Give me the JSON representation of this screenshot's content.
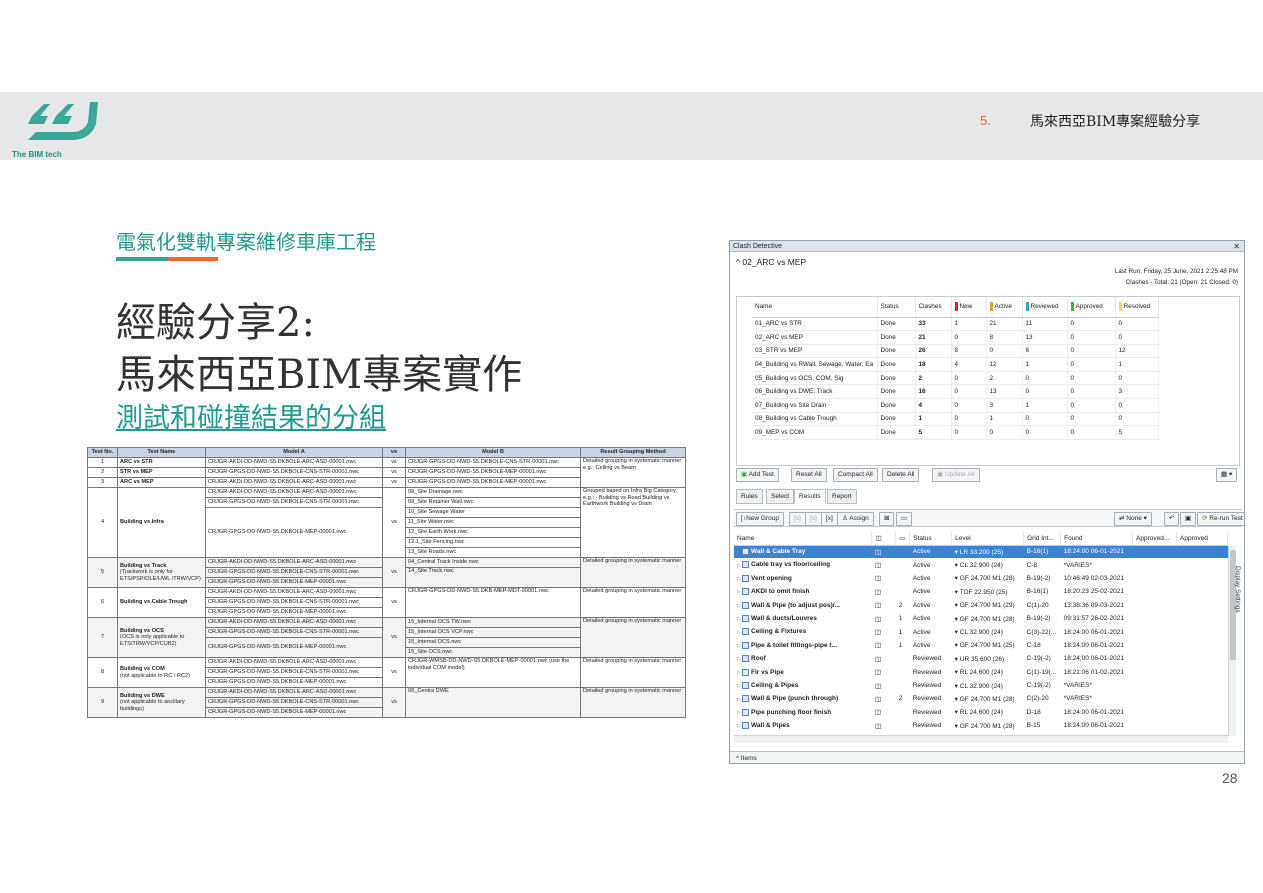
{
  "header": {
    "logo_text": "The BIM tech",
    "section_number": "5.",
    "section_title": "馬來西亞BIM專案經驗分享"
  },
  "slide": {
    "project_title": "電氣化雙軌專案維修車庫工程",
    "title_line1": "經驗分享2:",
    "title_line2": "馬來西亞BIM專案實作",
    "subtitle": "測試和碰撞結果的分組",
    "page_number": "28"
  },
  "test_table": {
    "headers": [
      "Test No.",
      "Test Name",
      "Model A",
      "vs",
      "Model B",
      "Result Grouping Method"
    ],
    "rows": [
      {
        "no": "1",
        "name": "ARC vs STR",
        "a": "CRJGR-AKDI-DD-NWD-S5.DKBOLE-ARC-ASD-00001.nwc",
        "vs": "vs",
        "b": "CRJGR-GPGS-DD-NWD-S5.DKBOLE-CNS-STR-00001.nwc",
        "method": "Detailed grouping in systematic manner e.g.: Ceiling vs Beam"
      },
      {
        "no": "2",
        "name": "STR vs MEP",
        "a": "CRJGR-GPGS-DD-NWD-S5.DKBOLE-CNS-STR-00001.nwc",
        "vs": "vs",
        "b": "CRJGR-GPGS-DD-NWD-S5.DKBOLE-MEP-00001.nwc"
      },
      {
        "no": "3",
        "name": "ARC vs MEP",
        "a": "CRJGR-AKDI-DD-NWD-S5.DKBOLE-ARC-ASD-00001.nwc",
        "vs": "vs",
        "b": "CRJGR-GPGS-DD-NWD-S5.DKBOLE-MEP-00001.nwc"
      },
      {
        "no": "4",
        "name": "Building vs Infra",
        "a_list": [
          "CRJGR-AKDI-DD-NWD-S5.DKBOLE-ARC-ASD-00001.nwc",
          "CRJGR-GPGS-DD-NWD-S5.DKBOLE-CNS-STR-00001.nwc",
          "CRJGR-GPGS-DD-NWD-S5.DKBOLE-MEP-00001.nwc"
        ],
        "vs": "vs",
        "b_list": [
          "08_Site Drainage.nwc",
          "09_Site Retainer Wall.nwc",
          "10_Site Sewage Water",
          "11_Site Water.nwc",
          "12_Site Earth Work.nwc",
          "12.1_Site Fencing.nwc",
          "13_Site Roads.nwc"
        ],
        "method": "Grouped based on Infra Big Category, e.g.: - Building vs Road Building vs Earthwork Building vs Drain"
      },
      {
        "no": "5",
        "name": "Building vs Track",
        "name_note": "(Trackwork is only for ETS/PSP/OLE/UWL /TRW/VCP)",
        "a_list": [
          "CRJGR-AKDI-DD-NWD-S5.DKBOLE-ARC-ASD-00001.nwc",
          "CRJGR-GPGS-DD-NWD-S5.DKBOLE-CNS-STR-00001.nwc",
          "CRJGR-GPGS-DD-NWD-S5.DKBOLE-MEP-00001.nwc"
        ],
        "vs": "vs",
        "b_list": [
          "04_Central Track Inside.nwc",
          "14_Site Track.nwc"
        ],
        "method": "Detailed grouping in systematic manner"
      },
      {
        "no": "6",
        "name": "Building vs Cable Trough",
        "a_list": [
          "CRJGR-AKDI-DD-NWD-S5.DKBOLE-ARC-ASD-00001.nwc",
          "CRJGR-GPGS-DD-NWD-S5.DKBOLE-CNS-STR-00001.nwc",
          "CRJGR-GPGS-DD-NWD-S5.DKBOLE-MEP-00001.nwc"
        ],
        "vs": "vs",
        "b": "CRJGR-GPGS-DD-NWD-S5.DKB-MEP-MDT-00001.nwc",
        "method": "Detailed grouping in systematic manner"
      },
      {
        "no": "7",
        "name": "Building vs OCS",
        "name_note": "(OCS is only applicable to ETS/TRW/VCP/CUB2)",
        "a_list": [
          "CRJGR-AKDI-DD-NWD-S5.DKBOLE-ARC-ASD-00001.nwc",
          "CRJGR-GPGS-DD-NWD-S5.DKBOLE-CNS-STR-00001.nwc",
          "CRJGR-GPGS-DD-NWD-S5.DKBOLE-MEP-00001.nwc"
        ],
        "vs": "vs",
        "b_list": [
          "15_Internal OCS TW.nwc",
          "15_Internal OCS VCP.nwc",
          "15_Internal OCS.nwc",
          "15_Site OCS.nwc"
        ],
        "method": "Detailed grouping in systematic manner"
      },
      {
        "no": "8",
        "name": "Building vs COM",
        "name_note": "(not applicable to RC / RC2)",
        "a_list": [
          "CRJGR-AKDI-DD-NWD-S5.DKBOLE-ARC-ASD-00001.nwc",
          "CRJGR-GPGS-DD-NWD-S5.DKBOLE-CNS-STR-00001.nwc",
          "CRJGR-GPGS-DD-NWD-S5.DKBOLE-MEP-00001.nwc"
        ],
        "vs": "vs",
        "b": "CRJGR-WMSB-DD-NWD-S5.DKBOLE-MEP-00001.nwc (use the individual COM model)",
        "method": "Detailed grouping in systematic manner"
      },
      {
        "no": "9",
        "name": "Building vs DWE",
        "name_note": "(not applicable to ancillary buildings)",
        "a_list": [
          "CRJGR-AKDI-DD-NWD-S5.DKBOLE-ARC-ASD-00001.nwc",
          "CRJGR-GPGS-DD-NWD-S5.DKBOLE-CNS-STR-00001.nwc",
          "CRJGR-GPGS-DD-NWD-S5.DKBOLE-MEP-00001.nwc"
        ],
        "vs": "vs",
        "b": "00_Centra DWE",
        "method": "Detailed grouping in systematic manner"
      }
    ]
  },
  "clash": {
    "window_title": "Clash Detective",
    "current_test": "02_ARC vs MEP",
    "last_run": "Last Run:  Friday, 25 June, 2021 2:25:48 PM",
    "summary": "Clashes - Total: 21  (Open: 21  Closed: 0)",
    "test_headers": [
      "Name",
      "Status",
      "Clashes",
      "New",
      "Active",
      "Reviewed",
      "Approved",
      "Resolved"
    ],
    "status_colors": {
      "new": "#e02020",
      "active": "#f0a020",
      "reviewed": "#30a0e0",
      "approved": "#30c030",
      "resolved": "#f0e040"
    },
    "tests": [
      [
        "01_ARC vs STR",
        "Done",
        "33",
        "1",
        "21",
        "11",
        "0",
        "0"
      ],
      [
        "02_ARC vs MEP",
        "Done",
        "21",
        "0",
        "8",
        "13",
        "0",
        "0"
      ],
      [
        "03_STR vs MEP",
        "Done",
        "26",
        "8",
        "0",
        "6",
        "0",
        "12"
      ],
      [
        "04_Building vs RWall, Sewage, Water, Ea",
        "Done",
        "18",
        "4",
        "12",
        "1",
        "0",
        "1"
      ],
      [
        "05_Building vs OCS, COM, Sig",
        "Done",
        "2",
        "0",
        "2",
        "0",
        "0",
        "0"
      ],
      [
        "06_Building vs DWE, Track",
        "Done",
        "16",
        "0",
        "13",
        "0",
        "0",
        "3"
      ],
      [
        "07_Building vs Site Drain",
        "Done",
        "4",
        "0",
        "3",
        "1",
        "0",
        "0"
      ],
      [
        "08_Building vs Cable Trough",
        "Done",
        "1",
        "0",
        "1",
        "0",
        "0",
        "0"
      ],
      [
        "09_MEP vs COM",
        "Done",
        "5",
        "0",
        "0",
        "0",
        "0",
        "5"
      ]
    ],
    "buttons": {
      "add_test": "Add Test",
      "reset_all": "Reset All",
      "compact_all": "Compact All",
      "delete_all": "Delete All",
      "update_all": "Update All"
    },
    "tabs": [
      "Rules",
      "Select",
      "Results",
      "Report"
    ],
    "result_toolbar": {
      "new_group": "New Group",
      "assign": "Assign",
      "none": "None",
      "rerun": "Re-run Test"
    },
    "result_headers": [
      "Name",
      "",
      "",
      "Status",
      "Level",
      "Grid Int...",
      "Found",
      "Approved...",
      "Approved"
    ],
    "results": [
      [
        "Wall & Cable Tray",
        "",
        "Active",
        "LR 33.200 (25)",
        "B-16(1)",
        "18:24:00 06-01-2021"
      ],
      [
        "Cable tray vs floor/ceiling",
        "",
        "Active",
        "CL 32.900 (24)",
        "C-8",
        "*VARIES*"
      ],
      [
        "Vent opening",
        "",
        "Active",
        "GF 24.700 M1 (28)",
        "B-19(-2)",
        "10:46:49 02-03-2021"
      ],
      [
        "AKDI to omit finish",
        "",
        "Active",
        "TOF 22.950 (25)",
        "B-16(1)",
        "18:20:23 25-02-2021"
      ],
      [
        "Wall & Pipe (to adjust pos)/...",
        "2",
        "Active",
        "GF 24.700 M1 (29)",
        "C(1)-20",
        "13:38:36 09-03-2021"
      ],
      [
        "Wall & ducts/Louvres",
        "1",
        "Active",
        "GF 24.700 M1 (28)",
        "B-19(-2)",
        "09:31:57 26-02-2021"
      ],
      [
        "Ceiling & Fixtures",
        "1",
        "Active",
        "CL 32.900 (24)",
        "C(3)-22(...",
        "18:24:00 06-01-2021"
      ],
      [
        "Pipe & toilet fittings-pipe t...",
        "1",
        "Active",
        "GF 24.700 M1 (25)",
        "C-18",
        "18:24:00 06-01-2021"
      ],
      [
        "Roof",
        "",
        "Reviewed",
        "UR 35.600 (26)",
        "C-19(-2)",
        "18:24:00 06-01-2021"
      ],
      [
        "Flr vs Pipe",
        "",
        "Reviewed",
        "RL 24.600 (24)",
        "C(1)-19(...",
        "18:21:06 01-02-2021"
      ],
      [
        "Ceiling & Pipes",
        "",
        "Reviewed",
        "CL 32.900 (24)",
        "C-19(-2)",
        "*VARIES*"
      ],
      [
        "Wall & Pipe (punch through)",
        "2",
        "Reviewed",
        "GF 24.700 M1 (28)",
        "C(2)-20",
        "*VARIES*"
      ],
      [
        "Pipe punching floor finish",
        "",
        "Reviewed",
        "RL 24.600 (24)",
        "D-18",
        "18:24:00 06-01-2021"
      ],
      [
        "Wall & Pipes",
        "",
        "Reviewed",
        "GF 24.700 M1 (28)",
        "B-15",
        "18:24:00 06-01-2021"
      ]
    ],
    "side_tab": "Display Settings",
    "items_label": "Items"
  }
}
